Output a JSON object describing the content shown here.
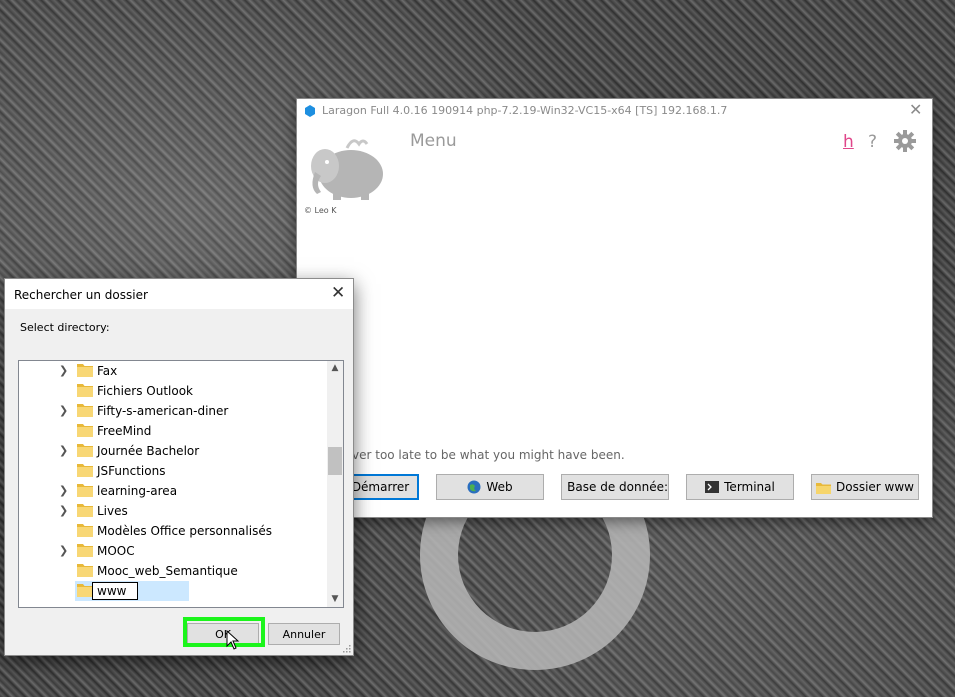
{
  "laragon": {
    "title": "Laragon Full 4.0.16 190914 php-7.2.19-Win32-VC15-x64 [TS]  192.168.1.7",
    "close_icon": "close-icon",
    "menu_label": "Menu",
    "copyright": "© Leo K",
    "help_h": "h",
    "help_q": "?",
    "quote": "ver too late to be what you might have been.",
    "buttons": [
      {
        "label": "Démarrer",
        "icon": ""
      },
      {
        "label": "Web",
        "icon": "globe-icon"
      },
      {
        "label": "Base de donnée:",
        "icon": "database-icon"
      },
      {
        "label": "Terminal",
        "icon": "terminal-icon"
      },
      {
        "label": "Dossier www",
        "icon": "folder-icon"
      }
    ],
    "accent_color": "#0078d7",
    "h_color": "#e0468a"
  },
  "dialog": {
    "title": "Rechercher un dossier",
    "label": "Select directory:",
    "folders": [
      {
        "name": "Fax",
        "expandable": true
      },
      {
        "name": "Fichiers Outlook",
        "expandable": false
      },
      {
        "name": "Fifty-s-american-diner",
        "expandable": true
      },
      {
        "name": "FreeMind",
        "expandable": false
      },
      {
        "name": "Journée Bachelor",
        "expandable": true
      },
      {
        "name": "JSFunctions",
        "expandable": false
      },
      {
        "name": "learning-area",
        "expandable": true
      },
      {
        "name": "Lives",
        "expandable": true
      },
      {
        "name": "Modèles Office personnalisés",
        "expandable": false
      },
      {
        "name": "MOOC",
        "expandable": true
      },
      {
        "name": "Mooc_web_Semantique",
        "expandable": false
      },
      {
        "name": "www",
        "expandable": false,
        "editing": true
      }
    ],
    "ok_label": "OK",
    "cancel_label": "Annuler",
    "highlight_color": "#1bf51b"
  }
}
